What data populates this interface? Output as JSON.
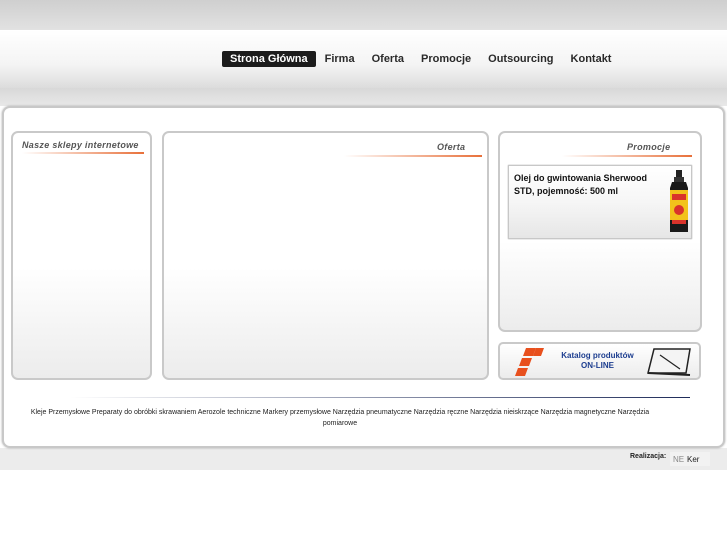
{
  "nav": {
    "items": [
      {
        "label": "Strona Główna",
        "active": true
      },
      {
        "label": "Firma",
        "active": false
      },
      {
        "label": "Oferta",
        "active": false
      },
      {
        "label": "Promocje",
        "active": false
      },
      {
        "label": "Outsourcing",
        "active": false
      },
      {
        "label": "Kontakt",
        "active": false
      }
    ]
  },
  "panels": {
    "shops": {
      "title": "Nasze sklepy internetowe"
    },
    "offer": {
      "title": "Oferta"
    },
    "promo": {
      "title": "Promocje",
      "item_text": "Olej do gwintowania Sherwood STD, pojemność: 500 ml"
    }
  },
  "catalog": {
    "line1": "Katalog produktów",
    "line2": "ON-LINE"
  },
  "categories": [
    "Kleje Przemysłowe",
    "Preparaty do obróbki skrawaniem",
    "Aerozole techniczne",
    "Markery przemysłowe",
    "Narzędzia pneumatyczne",
    "Narzędzia ręczne",
    "Narzędzia nieiskrzące",
    "Narzędzia magnetyczne",
    "Narzędzia pomiarowe"
  ],
  "footer": {
    "label": "Realizacja:",
    "logo_text": "Ker"
  },
  "colors": {
    "accent": "#e8703a",
    "nav_active_bg": "#1c1c1c",
    "catalog_text": "#1c3d8f"
  }
}
